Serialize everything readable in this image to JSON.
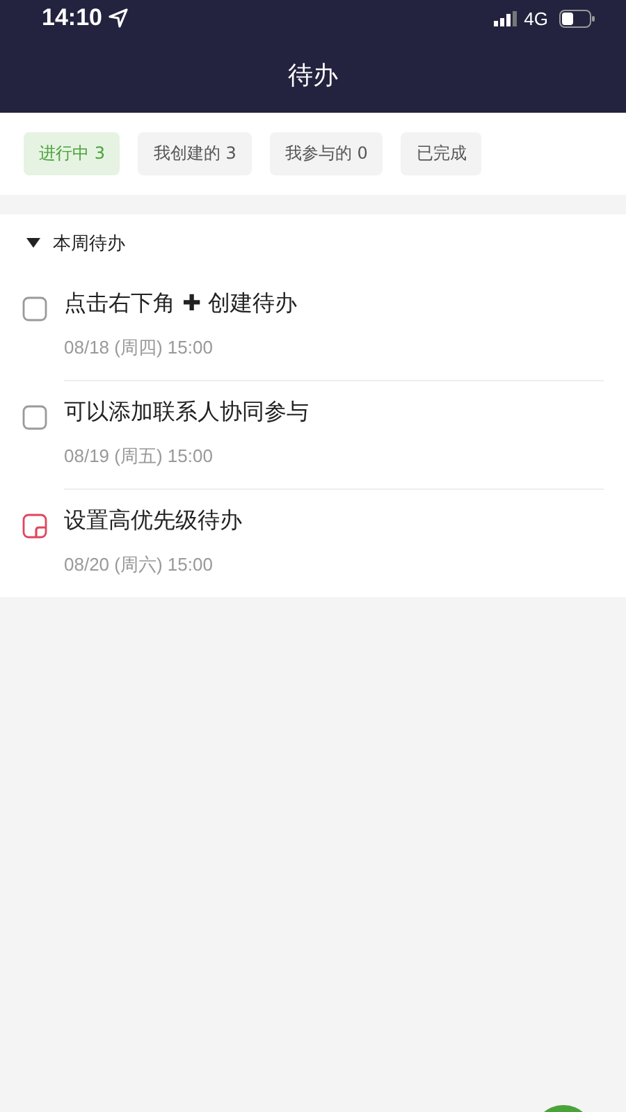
{
  "status_bar": {
    "time": "14:10",
    "network": "4G"
  },
  "header": {
    "title": "待办"
  },
  "tabs": [
    {
      "label": "进行中 3",
      "selected": true
    },
    {
      "label": "我创建的 3",
      "selected": false
    },
    {
      "label": "我参与的 0",
      "selected": false
    },
    {
      "label": "已完成",
      "selected": false
    }
  ],
  "section": {
    "title": "本周待办",
    "expanded": true,
    "tasks": [
      {
        "title": "点击右下角 ✚ 创建待办",
        "due": "08/18 (周四) 15:00",
        "checked": false,
        "high_priority": false
      },
      {
        "title": "可以添加联系人协同参与",
        "due": "08/19 (周五) 15:00",
        "checked": false,
        "high_priority": false
      },
      {
        "title": "设置高优先级待办",
        "due": "08/20 (周六) 15:00",
        "checked": false,
        "high_priority": true
      }
    ]
  }
}
